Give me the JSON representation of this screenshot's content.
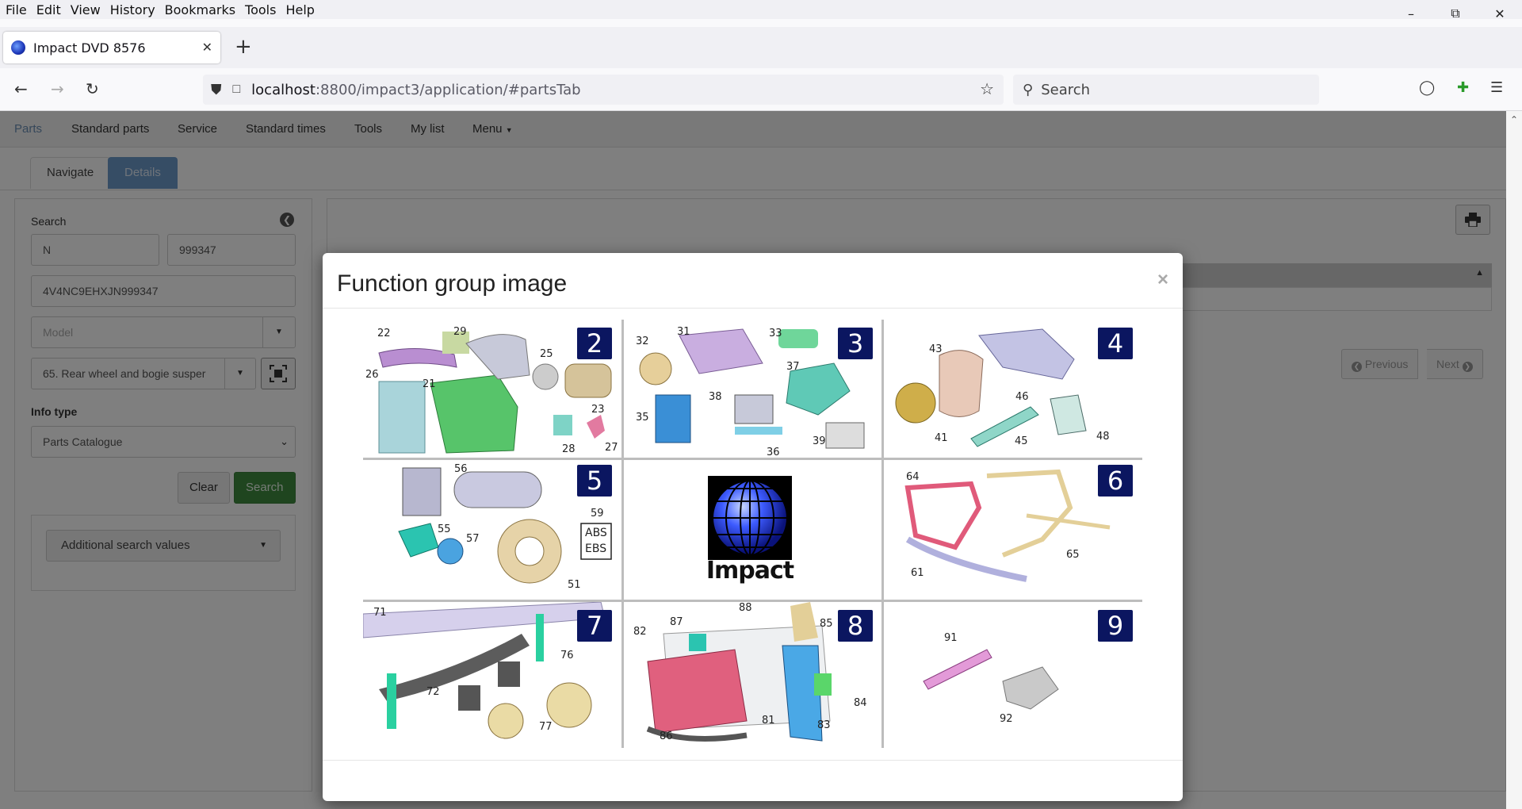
{
  "browser": {
    "menu": [
      "File",
      "Edit",
      "View",
      "History",
      "Bookmarks",
      "Tools",
      "Help"
    ],
    "tab_title": "Impact DVD 8576",
    "url_host": "localhost",
    "url_rest": ":8800/impact3/application/#partsTab",
    "search_placeholder": "Search"
  },
  "app": {
    "nav": [
      "Parts",
      "Standard parts",
      "Service",
      "Standard times",
      "Tools",
      "My list",
      "Menu"
    ],
    "subtabs": {
      "navigate": "Navigate",
      "details": "Details"
    },
    "search_panel": {
      "title": "Search",
      "field_prefix": "N",
      "field_number": "999347",
      "vin": "4V4NC9EHXJN999347",
      "model_placeholder": "Model",
      "function_group": "65. Rear wheel and bogie susper",
      "info_type_label": "Info type",
      "info_type_value": "Parts Catalogue",
      "clear": "Clear",
      "search": "Search",
      "additional": "Additional search values"
    },
    "pager": {
      "previous": "Previous",
      "next": "Next"
    }
  },
  "modal": {
    "title": "Function group image",
    "close": "×",
    "center_logo_text": "Impact",
    "groups": [
      {
        "badge": "2",
        "labels": [
          "22",
          "29",
          "25",
          "26",
          "21",
          "23",
          "28",
          "27"
        ]
      },
      {
        "badge": "3",
        "labels": [
          "32",
          "31",
          "33",
          "37",
          "35",
          "38",
          "36",
          "39"
        ]
      },
      {
        "badge": "4",
        "labels": [
          "43",
          "46",
          "41",
          "45",
          "48"
        ]
      },
      {
        "badge": "5",
        "labels": [
          "56",
          "59",
          "55",
          "57",
          "51"
        ],
        "box_text": [
          "ABS",
          "EBS"
        ]
      },
      {
        "badge": "6",
        "labels": [
          "64",
          "65",
          "61"
        ]
      },
      {
        "badge": "7",
        "labels": [
          "71",
          "76",
          "72",
          "77"
        ]
      },
      {
        "badge": "8",
        "labels": [
          "88",
          "87",
          "85",
          "82",
          "84",
          "81",
          "83",
          "86"
        ]
      },
      {
        "badge": "9",
        "labels": [
          "91",
          "92"
        ]
      }
    ]
  }
}
